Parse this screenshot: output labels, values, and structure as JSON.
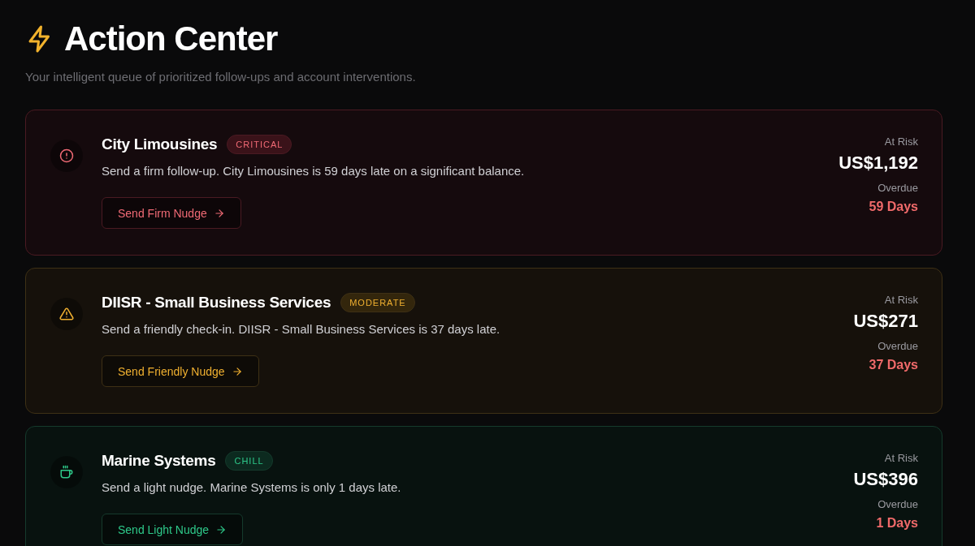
{
  "header": {
    "title": "Action Center",
    "subtitle": "Your intelligent queue of prioritized follow-ups and account interventions."
  },
  "actions": [
    {
      "kind": "critical",
      "account": "City Limousines",
      "badge": "CRITICAL",
      "message": "Send a firm follow-up. City Limousines is 59 days late on a significant balance.",
      "button": "Send Firm Nudge",
      "risk_label": "At Risk",
      "risk_amount": "US$1,192",
      "overdue_label": "Overdue",
      "overdue_days": "59 Days"
    },
    {
      "kind": "moderate",
      "account": "DIISR - Small Business Services",
      "badge": "MODERATE",
      "message": "Send a friendly check-in. DIISR - Small Business Services is 37 days late.",
      "button": "Send Friendly Nudge",
      "risk_label": "At Risk",
      "risk_amount": "US$271",
      "overdue_label": "Overdue",
      "overdue_days": "37 Days"
    },
    {
      "kind": "chill",
      "account": "Marine Systems",
      "badge": "CHILL",
      "message": "Send a light nudge. Marine Systems is only 1 days late.",
      "button": "Send Light Nudge",
      "risk_label": "At Risk",
      "risk_amount": "US$396",
      "overdue_label": "Overdue",
      "overdue_days": "1 Days"
    }
  ]
}
